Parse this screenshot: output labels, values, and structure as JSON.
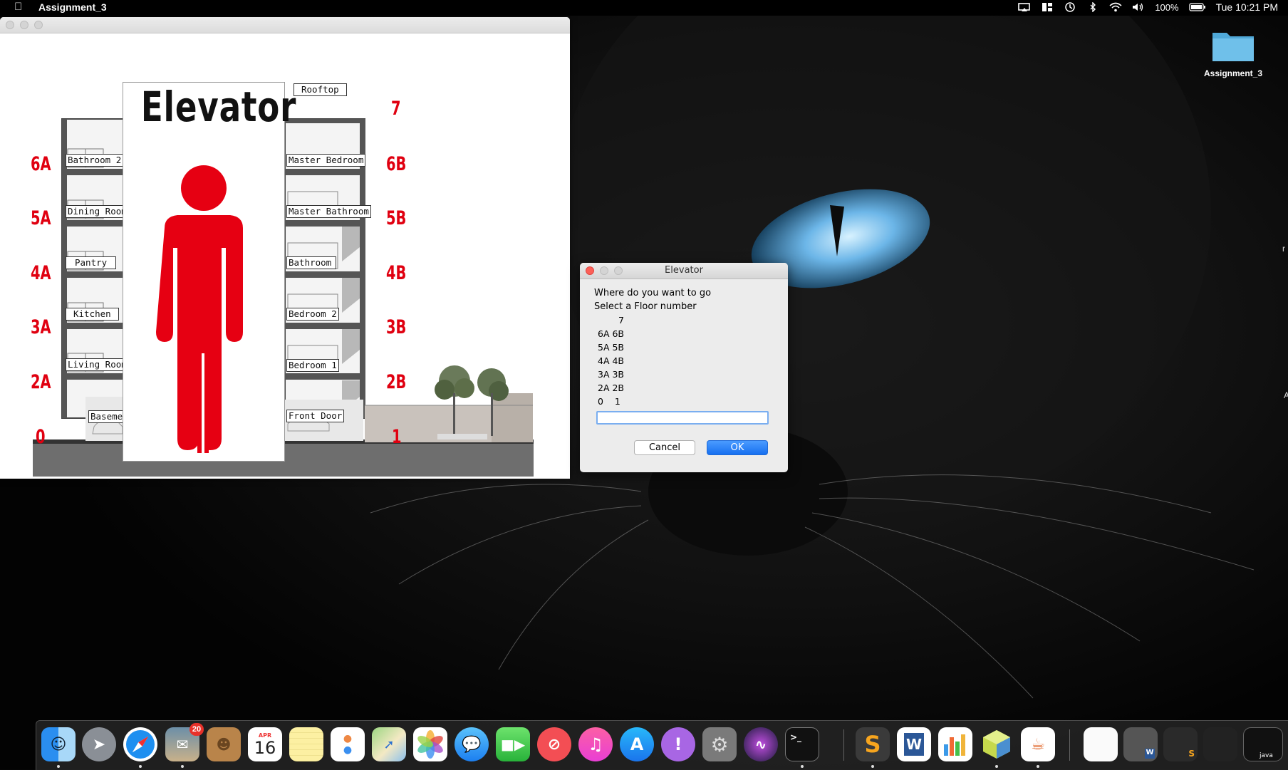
{
  "menubar": {
    "app_name": "Assignment_3",
    "battery": "100%",
    "clock": "Tue 10:21 PM"
  },
  "desktop": {
    "folder_label": "Assignment_3",
    "edge_chars": [
      "r",
      "A"
    ]
  },
  "building": {
    "elevator_title": "Elevator",
    "left_floors": [
      "6A",
      "5A",
      "4A",
      "3A",
      "2A",
      "0"
    ],
    "right_floors": [
      "7",
      "6B",
      "5B",
      "4B",
      "3B",
      "2B",
      "1"
    ],
    "left_rooms": [
      "Bathroom 2",
      "Dining Room",
      "Pantry",
      "Kitchen",
      "Living Room",
      "Baseme"
    ],
    "right_rooms": [
      "Rooftop",
      "Master Bedroom",
      "Master Bathroom",
      "Bathroom",
      "Bedroom 2",
      "Bedroom 1",
      "Front Door"
    ],
    "colors": {
      "floor_label": "#e00010",
      "person": "#e60012"
    }
  },
  "dialog": {
    "title": "Elevator",
    "prompt_line1": "Where do you want to go",
    "prompt_line2": "Select a Floor number",
    "options": [
      "7",
      "6A 6B",
      "5A 5B",
      "4A 4B",
      "3A 3B",
      "2A 2B",
      "0    1"
    ],
    "input_value": "",
    "cancel_label": "Cancel",
    "ok_label": "OK"
  },
  "dock": {
    "icons": [
      "finder-icon",
      "launchpad-icon",
      "safari-icon",
      "mail-icon",
      "contacts-icon",
      "calendar-icon",
      "notes-icon",
      "reminders-icon",
      "maps-icon",
      "photos-icon",
      "messages-icon",
      "facetime-icon",
      "news-icon",
      "itunes-icon",
      "app-store-icon",
      "feedback-icon",
      "system-preferences-icon",
      "siri-icon",
      "terminal-icon",
      "sublime-text-icon",
      "word-icon",
      "numbers-icon",
      "virtualbox-icon",
      "java-icon"
    ],
    "mail_badge": "20",
    "calendar_month": "APR",
    "calendar_day": "16",
    "java_label": "java"
  }
}
